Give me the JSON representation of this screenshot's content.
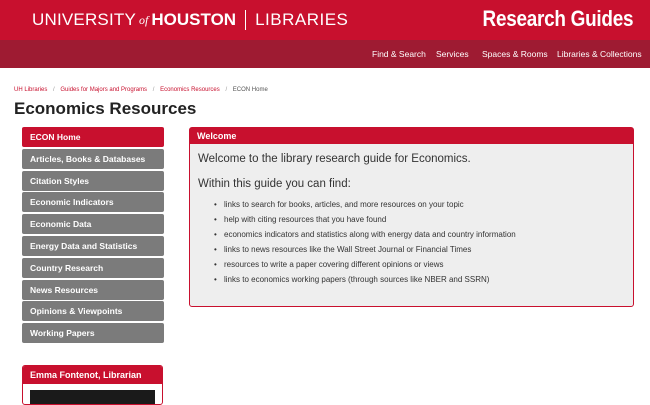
{
  "header": {
    "logo": {
      "part1": "UNIVERSITY",
      "part2": "of",
      "part3": "HOUSTON",
      "part4": "LIBRARIES"
    },
    "site_title": "Research Guides",
    "colors": {
      "primary": "#c8102e",
      "nav": "#9e1b32"
    }
  },
  "nav": {
    "items": [
      {
        "label": "Find & Search"
      },
      {
        "label": "Services"
      },
      {
        "label": "Spaces & Rooms"
      },
      {
        "label": "Libraries & Collections"
      }
    ]
  },
  "breadcrumb": {
    "items": [
      {
        "label": "UH Libraries"
      },
      {
        "label": "Guides for Majors and Programs"
      },
      {
        "label": "Economics Resources"
      },
      {
        "label": "ECON Home"
      }
    ]
  },
  "page": {
    "title": "Economics Resources"
  },
  "sidebar": {
    "items": [
      {
        "label": "ECON Home",
        "active": true
      },
      {
        "label": "Articles, Books & Databases"
      },
      {
        "label": "Citation Styles"
      },
      {
        "label": "Economic Indicators"
      },
      {
        "label": "Economic Data"
      },
      {
        "label": "Energy Data and Statistics"
      },
      {
        "label": "Country Research"
      },
      {
        "label": "News Resources"
      },
      {
        "label": "Opinions & Viewpoints"
      },
      {
        "label": "Working Papers"
      }
    ],
    "profile": {
      "title": "Emma Fontenot, Librarian"
    }
  },
  "welcome": {
    "heading": "Welcome",
    "intro": "Welcome to the library research guide for Economics.",
    "subheading": "Within this guide you can find:",
    "items": [
      "links to search for books, articles, and more resources on your topic",
      "help with citing resources that you have found",
      "economics indicators and statistics along with energy data and country information",
      "links to news resources like the Wall Street Journal or Financial Times",
      "resources to write a paper covering different opinions or views",
      "links to economics working papers (through sources like NBER and SSRN)"
    ]
  }
}
